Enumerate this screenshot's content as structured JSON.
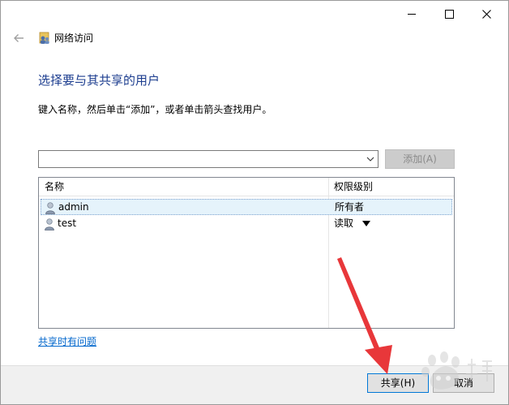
{
  "window": {
    "title": "网络访问"
  },
  "heading": "选择要与其共享的用户",
  "instructions": "键入名称，然后单击“添加”，或者单击箭头查找用户。",
  "combo": {
    "value": ""
  },
  "add_button": {
    "label": "添加(A)",
    "enabled": false
  },
  "user_list": {
    "columns": [
      "名称",
      "权限级别"
    ],
    "rows": [
      {
        "name": "admin",
        "permission": "所有者",
        "selected": true
      },
      {
        "name": "test",
        "permission": "读取",
        "has_dropdown": true
      }
    ]
  },
  "help_link": "共享时有问题",
  "footer": {
    "share_label": "共享(H)",
    "cancel_label": "取消"
  },
  "icons": {
    "back": "back-arrow-icon",
    "app": "network-users-icon",
    "user": "user-icon",
    "dropdown": "chevron-down-icon"
  },
  "colors": {
    "heading": "#1c3d8f",
    "link": "#0066cc",
    "selection": "#e5f3fb",
    "focus_border": "#0078d7",
    "annotation_arrow": "#e8373a"
  }
}
